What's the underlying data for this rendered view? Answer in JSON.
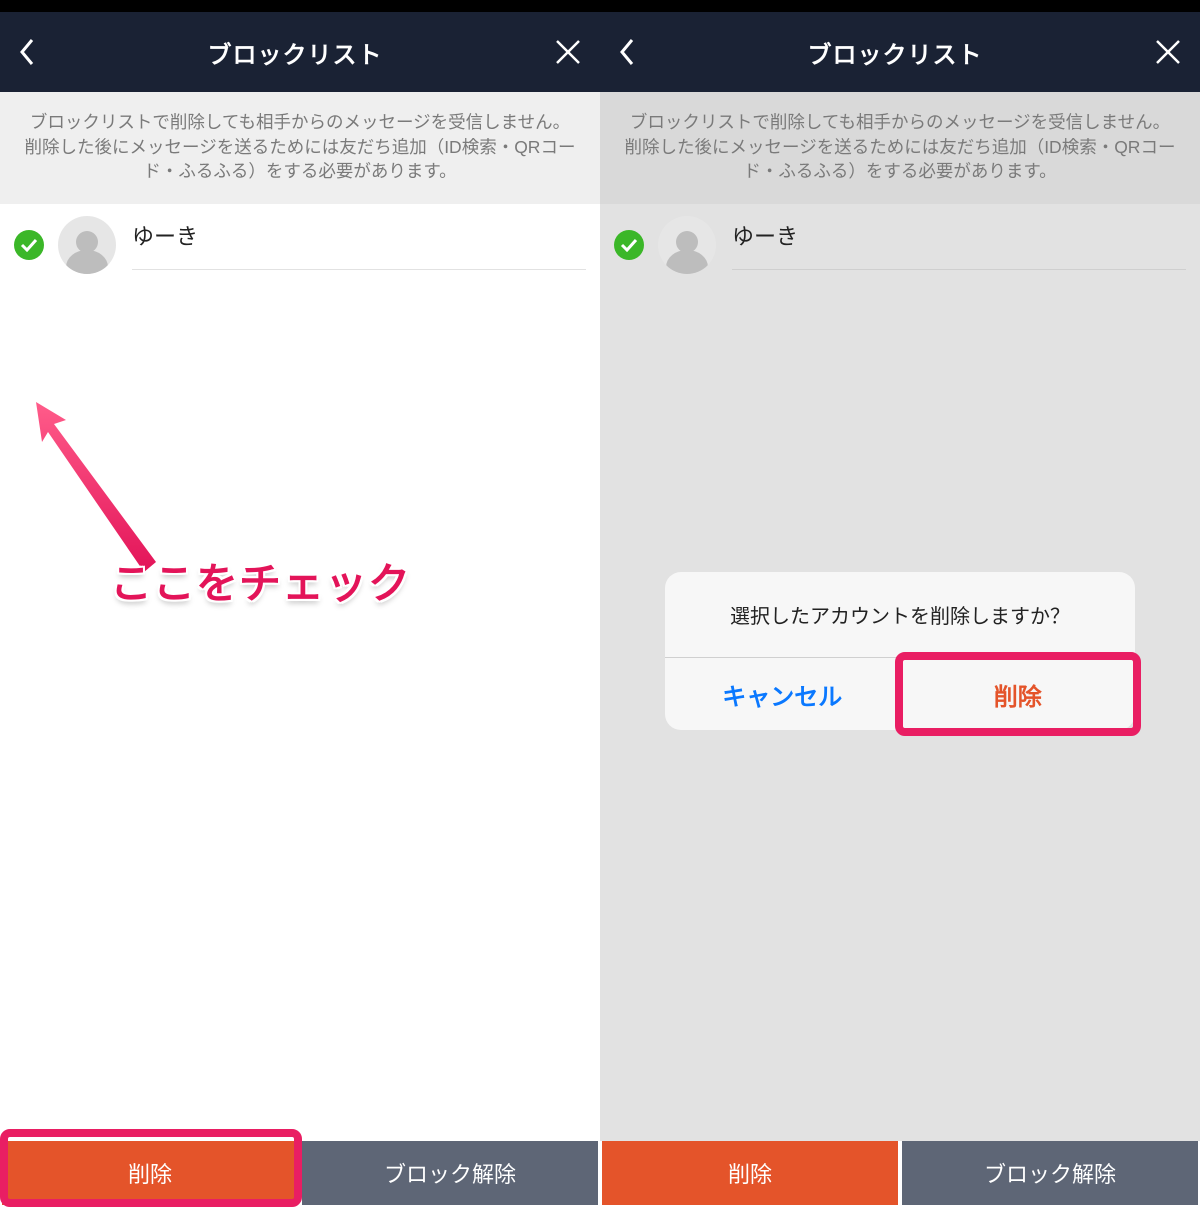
{
  "header": {
    "title": "ブロックリスト"
  },
  "info_text": "ブロックリストで削除しても相手からのメッセージを受信しません。\n削除した後にメッセージを送るためには友だち追加（ID検索・QRコード・ふるふる）をする必要があります。",
  "list": {
    "items": [
      {
        "name": "ゆーき",
        "checked": true
      }
    ]
  },
  "buttons": {
    "delete": "削除",
    "unblock": "ブロック解除"
  },
  "annotation": {
    "check_hint": "ここをチェック"
  },
  "dialog": {
    "message": "選択したアカウントを削除しますか？",
    "cancel": "キャンセル",
    "confirm": "削除"
  }
}
